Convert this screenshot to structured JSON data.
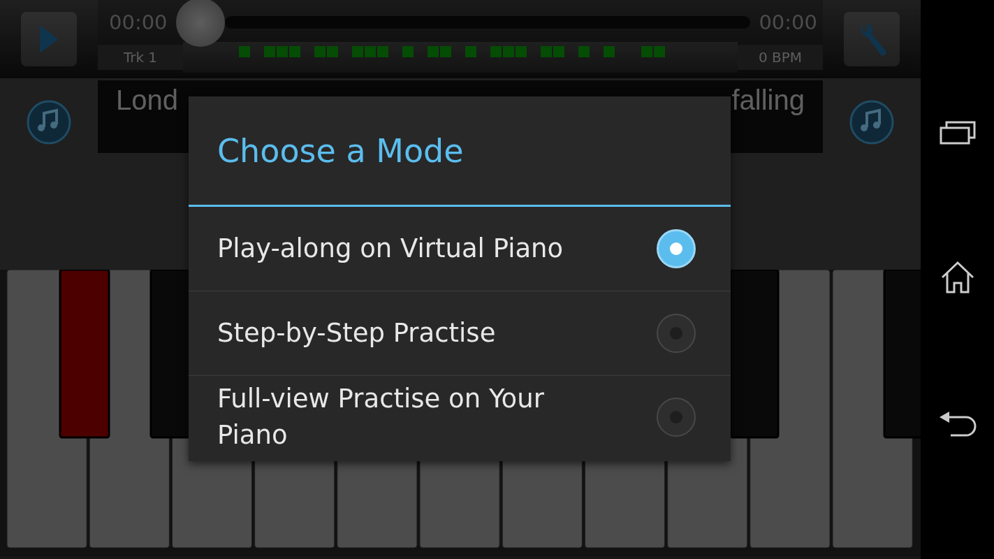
{
  "player": {
    "elapsed": "00:00",
    "total": "00:00",
    "progress": {
      "level": 0
    },
    "track": "Trk 1",
    "tempo": "0 BPM"
  },
  "lyrics": {
    "visible_start": "Lond",
    "visible_end": "falling"
  },
  "dialog": {
    "title": "Choose a Mode",
    "options": [
      {
        "label": "Play-along on Virtual Piano",
        "selected": true
      },
      {
        "label": "Step-by-Step Practise",
        "selected": false
      },
      {
        "label": "Full-view Practise on Your Piano",
        "selected": false
      }
    ]
  }
}
